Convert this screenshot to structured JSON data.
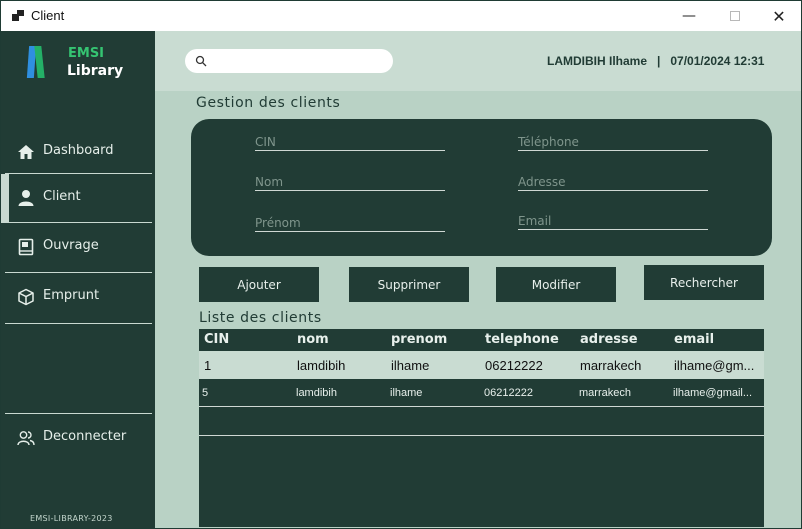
{
  "window": {
    "title": "Client",
    "minimize_glyph": "—",
    "close_glyph": "✕"
  },
  "sidebar": {
    "logo_line1": "EMSI",
    "logo_line2": "Library",
    "items": [
      {
        "label": "Dashboard",
        "icon": "home-icon"
      },
      {
        "label": "Client",
        "icon": "user-icon"
      },
      {
        "label": "Ouvrage",
        "icon": "book-icon"
      },
      {
        "label": "Emprunt",
        "icon": "box-icon"
      }
    ],
    "logout_label": "Deconnecter",
    "footer": "EMSI-LIBRARY-2023"
  },
  "header": {
    "search": {
      "value": "",
      "placeholder": ""
    },
    "user_info": "LAMDIBIH Ilhame   |   07/01/2024 12:31"
  },
  "form": {
    "title": "Gestion des clients",
    "fields": {
      "cin": "CIN",
      "nom": "Nom",
      "prenom": "Prénom",
      "telephone": "Téléphone",
      "adresse": "Adresse",
      "email": "Email"
    }
  },
  "actions": {
    "ajouter": "Ajouter",
    "supprimer": "Supprimer",
    "modifier": "Modifier",
    "rechercher": "Rechercher"
  },
  "table": {
    "title": "Liste des clients",
    "columns": [
      "CIN",
      "nom",
      "prenom",
      "telephone",
      "adresse",
      "email"
    ],
    "rows": [
      [
        "1",
        "lamdibih",
        "ilhame",
        "06212222",
        "marrakech",
        "ilhame@gm..."
      ],
      [
        "5",
        "lamdibih",
        "ilhame",
        "06212222",
        "marrakech",
        "ilhame@gmail..."
      ]
    ]
  },
  "colors": {
    "sidebar_bg": "#213c35",
    "accent_green": "#35c472",
    "accent_blue": "#2f8fe0",
    "content_bg": "#b9d2c5"
  }
}
